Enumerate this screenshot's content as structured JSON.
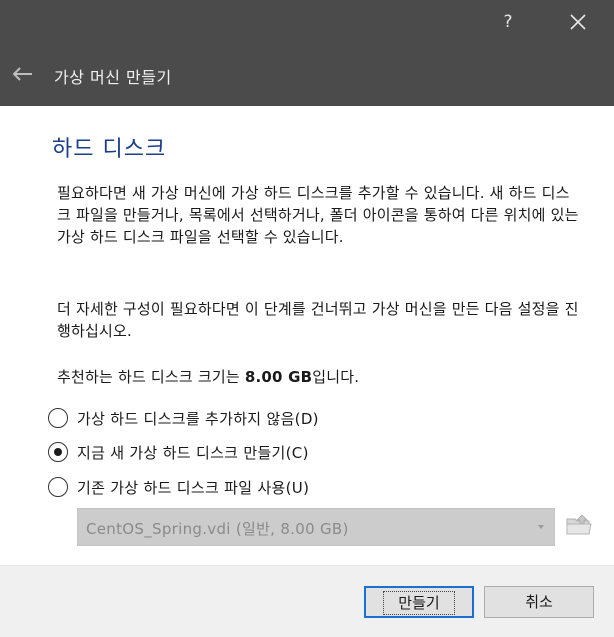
{
  "window": {
    "help_label": "?",
    "title": "가상 머신 만들기"
  },
  "page": {
    "heading": "하드 디스크",
    "paragraph1": "필요하다면 새 가상 머신에 가상 하드 디스크를 추가할 수 있습니다. 새 하드 디스크 파일을 만들거나, 목록에서 선택하거나, 폴더 아이콘을 통하여 다른 위치에 있는 가상 하드 디스크 파일을 선택할 수 있습니다.",
    "paragraph2": "더 자세한 구성이 필요하다면 이 단계를 건너뛰고 가상 머신을 만든 다음 설정을 진행하십시오.",
    "recommended_prefix": "추천하는 하드 디스크 크기는 ",
    "recommended_size": "8.00 GB",
    "recommended_suffix": "입니다."
  },
  "options": [
    {
      "label": "가상 하드 디스크를 추가하지 않음(D)",
      "checked": false
    },
    {
      "label": "지금 새 가상 하드 디스크 만들기(C)",
      "checked": true
    },
    {
      "label": "기존 가상 하드 디스크 파일 사용(U)",
      "checked": false
    }
  ],
  "disk_select": {
    "value": "CentOS_Spring.vdi (일반, 8.00 GB)",
    "enabled": false
  },
  "buttons": {
    "create": "만들기",
    "cancel": "취소"
  },
  "icons": {
    "back": "arrow-left-icon",
    "close": "close-icon",
    "folder": "folder-icon"
  },
  "colors": {
    "titlebar": "#4b4b4b",
    "heading": "#1a3d8c",
    "default_button_border": "#1a6fd1"
  }
}
